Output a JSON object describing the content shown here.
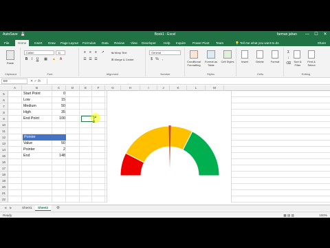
{
  "titlebar": {
    "autosave": "AutoSave",
    "title": "Book1 - Excel",
    "user": "farman jahan",
    "minimize": "—",
    "maximize": "☐",
    "close": "✕"
  },
  "tabs": [
    "File",
    "Home",
    "Insert",
    "Draw",
    "Page Layout",
    "Formulas",
    "Data",
    "Review",
    "View",
    "Developer",
    "Help",
    "Inquire",
    "Power Pivot",
    "Team"
  ],
  "tell_me": "Tell me what you want to do",
  "share": "Share",
  "ribbon": {
    "clipboard": {
      "label": "Clipboard",
      "paste": "Paste"
    },
    "font": {
      "label": "Font",
      "name": "Calibri",
      "size": "11",
      "bold": "B",
      "italic": "I",
      "underline": "U"
    },
    "alignment": {
      "label": "Alignment",
      "wrap": "Wrap Text",
      "merge": "Merge & Center"
    },
    "number": {
      "label": "Number",
      "format": "General",
      "currency": "$",
      "percent": "%",
      "comma": ","
    },
    "styles": {
      "label": "Styles",
      "conditional": "Conditional Formatting",
      "format_table": "Format as Table",
      "cell_styles": "Cell Styles"
    },
    "cells": {
      "label": "Cells",
      "insert": "Insert",
      "delete": "Delete",
      "format": "Format"
    },
    "editing": {
      "label": "Editing",
      "sort": "Sort & Filter",
      "find": "Find & Select"
    }
  },
  "formula_bar": {
    "name_box": "E9",
    "fx": "fx",
    "value": ""
  },
  "columns": [
    "A",
    "B",
    "C",
    "D",
    "E",
    "F",
    "G",
    "H",
    "I",
    "J",
    "K",
    "L",
    "M"
  ],
  "rows": [
    "5",
    "6",
    "7",
    "8",
    "9",
    "10",
    "11",
    "12",
    "13",
    "14",
    "15",
    "16",
    "17",
    "18",
    "19",
    "20",
    "21",
    "22",
    "23"
  ],
  "table1": [
    {
      "label": "Start Point",
      "value": "0"
    },
    {
      "label": "Low",
      "value": "15"
    },
    {
      "label": "Medium",
      "value": "50"
    },
    {
      "label": "High",
      "value": "35"
    },
    {
      "label": "End Point",
      "value": "100"
    }
  ],
  "table2": {
    "header": "Pointer",
    "header_color": "#4472c4",
    "rows": [
      {
        "label": "Value",
        "value": "50"
      },
      {
        "label": "Pointer",
        "value": "2"
      },
      {
        "label": "End",
        "value": "148"
      }
    ]
  },
  "chart_data": {
    "type": "pie",
    "style": "semicircle gauge (doughnut)",
    "series": [
      {
        "name": "Low",
        "value": 15,
        "color": "#ee0000"
      },
      {
        "name": "Medium",
        "value": 50,
        "color": "#ffc000"
      },
      {
        "name": "High",
        "value": 35,
        "color": "#00b050"
      }
    ],
    "pointer": {
      "value": 50,
      "width": 2,
      "color": "#c0504d"
    }
  },
  "sheets": [
    "Sheet1",
    "Sheet2"
  ],
  "active_sheet": "Sheet2",
  "status": {
    "ready": "Ready",
    "zoom": "100%"
  }
}
